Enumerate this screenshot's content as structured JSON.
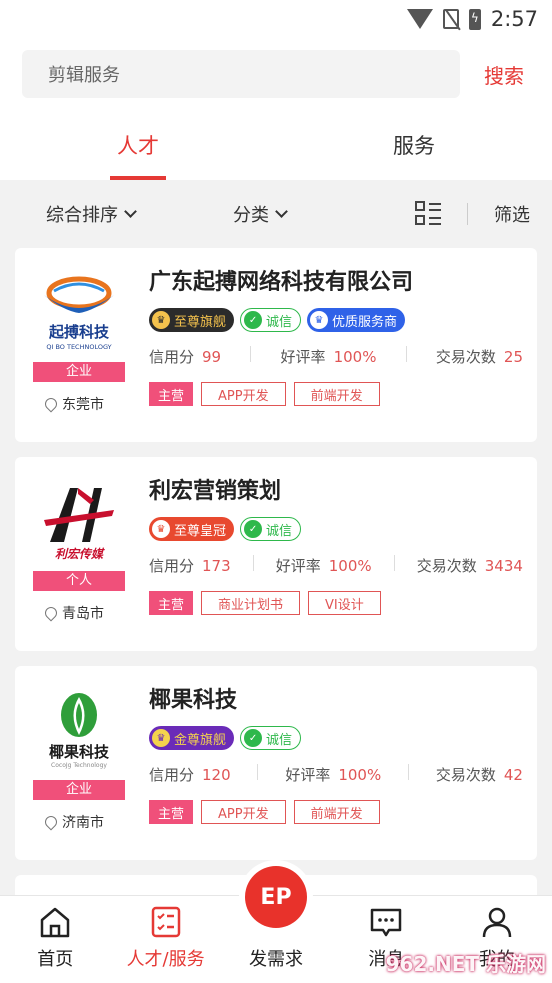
{
  "status": {
    "time": "2:57"
  },
  "search": {
    "placeholder": "剪辑服务",
    "button": "搜索"
  },
  "tabs": [
    {
      "label": "人才",
      "active": true
    },
    {
      "label": "服务",
      "active": false
    }
  ],
  "filters": {
    "sort": "综合排序",
    "category": "分类",
    "filter": "筛选"
  },
  "colors": {
    "accent": "#e53935",
    "tag_pink": "#f0507a"
  },
  "cards": [
    {
      "name": "广东起搏网络科技有限公司",
      "logo": {
        "title": "起搏科技",
        "subtitle": "QI BO TECHNOLOGY"
      },
      "type": "企业",
      "city": "东莞市",
      "badges": [
        {
          "label": "至尊旗舰",
          "style": "gold"
        },
        {
          "label": "诚信",
          "style": "cheng"
        },
        {
          "label": "优质服务商",
          "style": "quality"
        }
      ],
      "stats": {
        "credit_label": "信用分",
        "credit": "99",
        "rate_label": "好评率",
        "rate": "100%",
        "deals_label": "交易次数",
        "deals": "25"
      },
      "main_label": "主营",
      "tags": [
        "APP开发",
        "前端开发"
      ]
    },
    {
      "name": "利宏营销策划",
      "logo": {
        "title": "利宏传媒",
        "subtitle": ""
      },
      "type": "个人",
      "city": "青岛市",
      "badges": [
        {
          "label": "至尊皇冠",
          "style": "crown"
        },
        {
          "label": "诚信",
          "style": "cheng"
        }
      ],
      "stats": {
        "credit_label": "信用分",
        "credit": "173",
        "rate_label": "好评率",
        "rate": "100%",
        "deals_label": "交易次数",
        "deals": "3434"
      },
      "main_label": "主营",
      "tags": [
        "商业计划书",
        "VI设计"
      ]
    },
    {
      "name": "椰果科技",
      "logo": {
        "title": "椰果科技",
        "subtitle": "CocoJg Technology"
      },
      "type": "企业",
      "city": "济南市",
      "badges": [
        {
          "label": "金尊旗舰",
          "style": "gold2"
        },
        {
          "label": "诚信",
          "style": "cheng"
        }
      ],
      "stats": {
        "credit_label": "信用分",
        "credit": "120",
        "rate_label": "好评率",
        "rate": "100%",
        "deals_label": "交易次数",
        "deals": "42"
      },
      "main_label": "主营",
      "tags": [
        "APP开发",
        "前端开发"
      ]
    }
  ],
  "bottom_nav": [
    {
      "label": "首页",
      "icon": "home-icon"
    },
    {
      "label": "人才/服务",
      "icon": "list-icon",
      "active": true
    },
    {
      "label": "发需求",
      "icon": "ep-icon",
      "fab": "EP"
    },
    {
      "label": "消息",
      "icon": "message-icon"
    },
    {
      "label": "我的",
      "icon": "user-icon"
    }
  ],
  "watermark": "962.NET 乐游网"
}
